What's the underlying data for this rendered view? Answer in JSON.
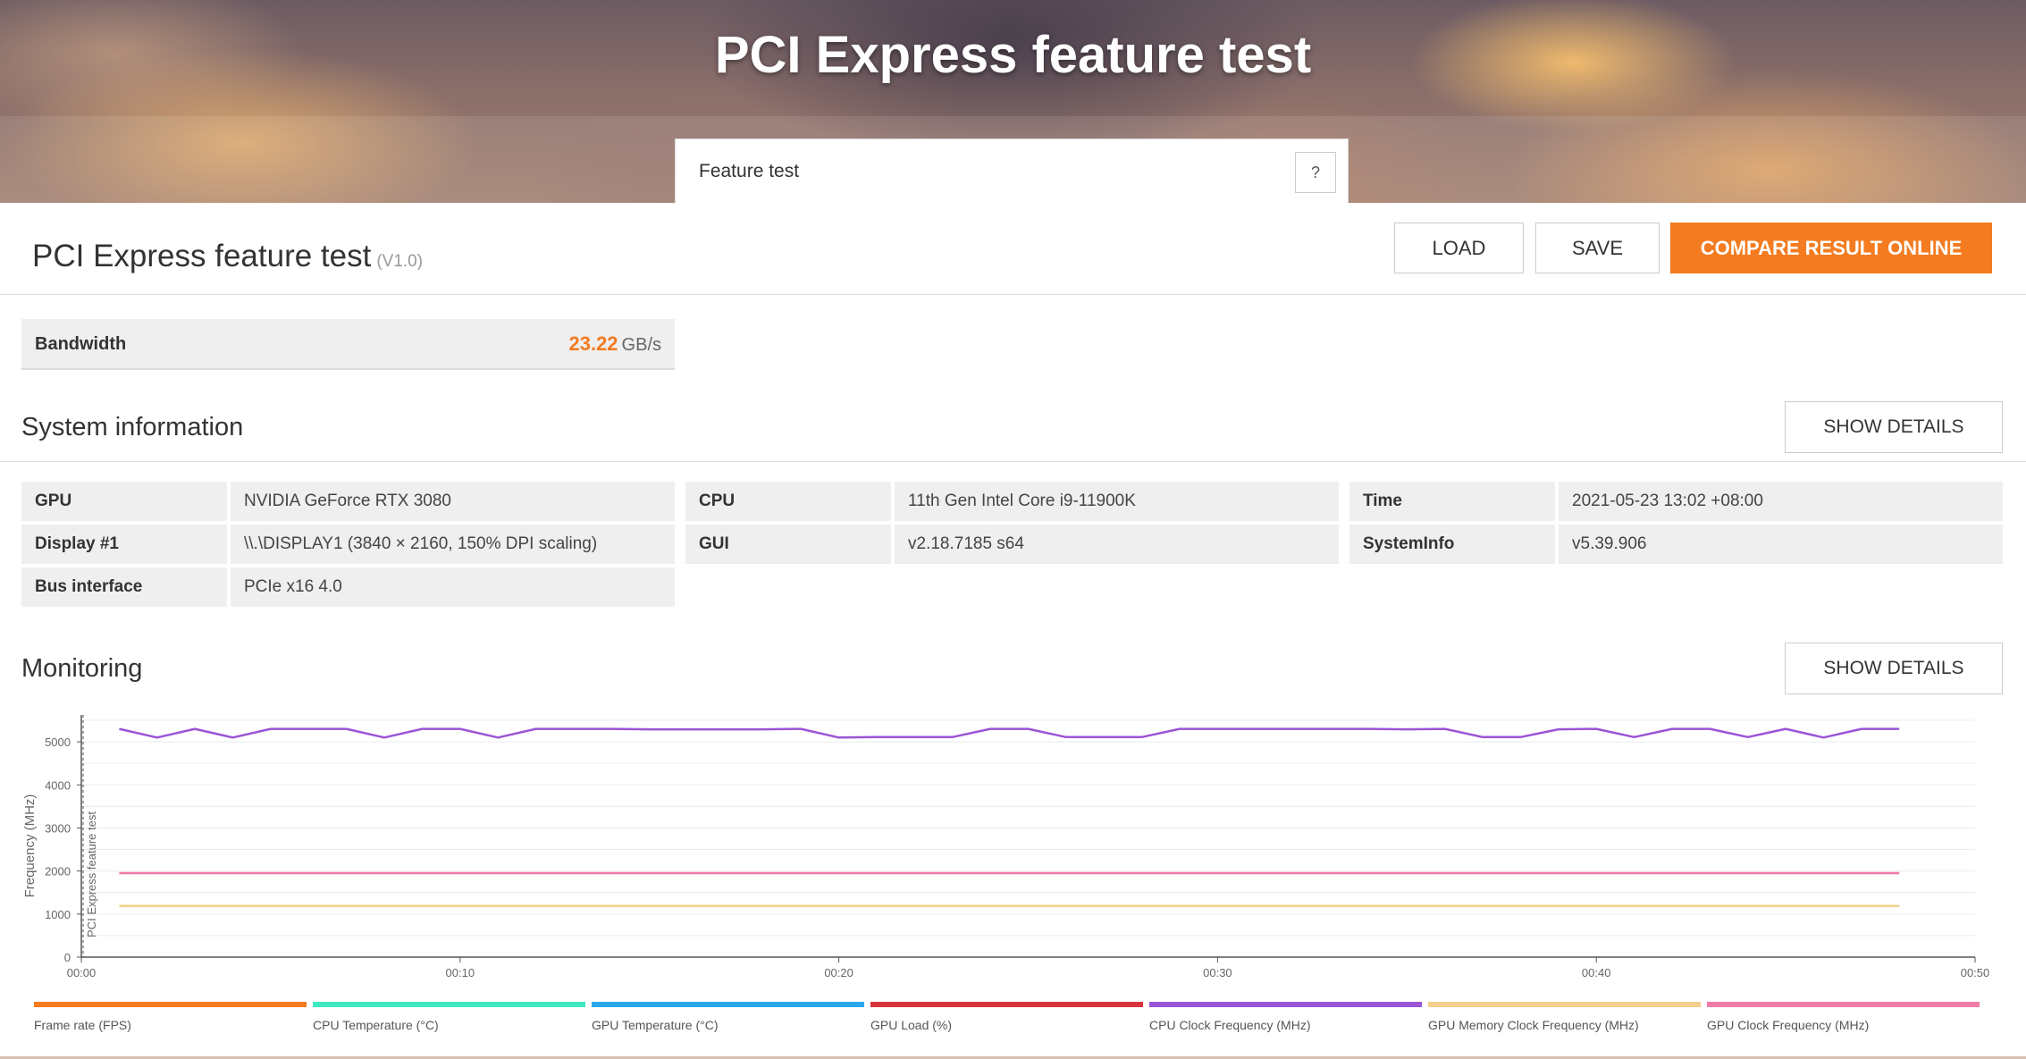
{
  "hero": {
    "title": "PCI Express feature test",
    "test_select_label": "Feature test",
    "help_label": "?"
  },
  "result": {
    "title": "PCI Express feature test",
    "version": "(V1.0)",
    "load_label": "LOAD",
    "save_label": "SAVE",
    "compare_label": "COMPARE RESULT ONLINE"
  },
  "bandwidth": {
    "label": "Bandwidth",
    "value": "23.22",
    "unit": "GB/s"
  },
  "system_info": {
    "title": "System information",
    "show_details_label": "SHOW DETAILS",
    "rows": [
      {
        "key": "GPU",
        "value": "NVIDIA GeForce RTX 3080"
      },
      {
        "key": "Display #1",
        "value": "\\\\.\\DISPLAY1 (3840 × 2160, 150% DPI scaling)"
      },
      {
        "key": "Bus interface",
        "value": "PCIe x16 4.0"
      },
      {
        "key": "CPU",
        "value": "11th Gen Intel Core i9-11900K"
      },
      {
        "key": "GUI",
        "value": "v2.18.7185 s64"
      },
      {
        "key": "Time",
        "value": "2021-05-23 13:02 +08:00"
      },
      {
        "key": "SystemInfo",
        "value": "v5.39.906"
      }
    ]
  },
  "monitoring": {
    "title": "Monitoring",
    "show_details_label": "SHOW DETAILS"
  },
  "colors": {
    "accent": "#f47b20"
  },
  "chart_data": {
    "type": "line",
    "ylabel": "Frequency (MHz)",
    "phase_label": "PCI Express feature test",
    "ylim": [
      0,
      5500
    ],
    "yticks": [
      0,
      1000,
      2000,
      3000,
      4000,
      5000
    ],
    "xlim": [
      0,
      50
    ],
    "xticks": [
      "00:00",
      "00:10",
      "00:20",
      "00:30",
      "00:40",
      "00:50"
    ],
    "grid": true,
    "series": [
      {
        "name": "CPU Clock Frequency (MHz)",
        "color": "#9b55d6",
        "x": [
          1,
          2,
          3,
          4,
          5,
          6,
          7,
          8,
          9,
          10,
          11,
          12,
          13,
          14,
          15,
          16,
          17,
          18,
          19,
          20,
          21,
          22,
          23,
          24,
          25,
          26,
          27,
          28,
          29,
          30,
          31,
          32,
          33,
          34,
          35,
          36,
          37,
          38,
          39,
          40,
          41,
          42,
          43,
          44,
          45,
          46,
          47,
          48
        ],
        "values": [
          5300,
          5100,
          5300,
          5100,
          5300,
          5300,
          5300,
          5100,
          5300,
          5300,
          5100,
          5300,
          5300,
          5300,
          5290,
          5290,
          5290,
          5290,
          5300,
          5100,
          5110,
          5110,
          5110,
          5300,
          5300,
          5110,
          5110,
          5110,
          5300,
          5300,
          5300,
          5300,
          5300,
          5300,
          5290,
          5300,
          5110,
          5110,
          5290,
          5300,
          5110,
          5300,
          5300,
          5110,
          5300,
          5100,
          5300,
          5300
        ]
      },
      {
        "name": "GPU Clock Frequency (MHz)",
        "color": "#f07aa8",
        "x": [
          1,
          48
        ],
        "values": [
          1950,
          1950
        ]
      },
      {
        "name": "GPU Memory Clock Frequency (MHz)",
        "color": "#f2cf8a",
        "x": [
          1,
          48
        ],
        "values": [
          1188,
          1188
        ]
      }
    ],
    "legend": [
      {
        "name": "Frame rate (FPS)",
        "color": "#f47b20"
      },
      {
        "name": "CPU Temperature (°C)",
        "color": "#3de8c2"
      },
      {
        "name": "GPU Temperature (°C)",
        "color": "#29a9ec"
      },
      {
        "name": "GPU Load (%)",
        "color": "#d9343d"
      },
      {
        "name": "CPU Clock Frequency (MHz)",
        "color": "#9b55d6"
      },
      {
        "name": "GPU Memory Clock Frequency (MHz)",
        "color": "#f2cf8a"
      },
      {
        "name": "GPU Clock Frequency (MHz)",
        "color": "#f07aa8"
      }
    ]
  }
}
